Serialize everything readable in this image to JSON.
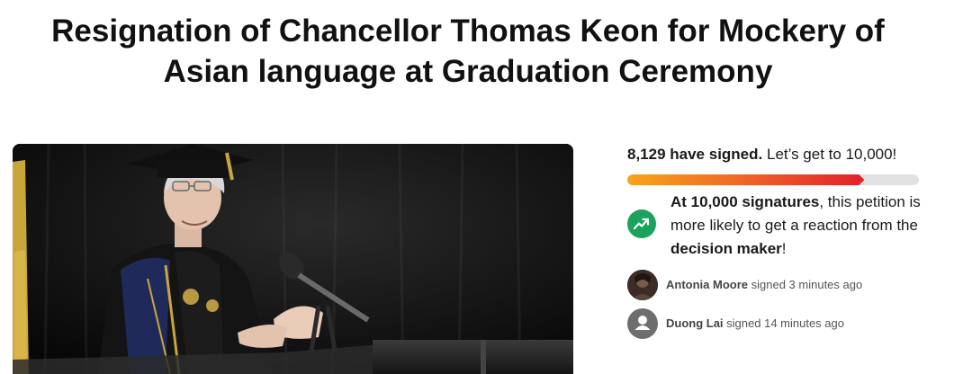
{
  "petition": {
    "title_line1": "Resignation of Chancellor Thomas Keon for Mockery of",
    "title_line2": "Asian language at Graduation Ceremony"
  },
  "progress": {
    "signed_count_text": "8,129 have signed.",
    "goal_text": "Let’s get to 10,000!",
    "signed": 8129,
    "goal": 10000,
    "gradient_colors": [
      "#f7a41c",
      "#f06a26",
      "#e3202d"
    ],
    "track_color": "#e2e2e2"
  },
  "milestone": {
    "icon": "trending-up-icon",
    "icon_color": "#1aa35c",
    "bold_part": "At 10,000 signatures",
    "middle_part": ", this petition is more likely to get a reaction from the ",
    "decision_maker": "decision maker",
    "end": "!"
  },
  "recent_signers": [
    {
      "name": "Antonia Moore",
      "action": "signed 3 minutes ago",
      "avatar": "photo-avatar"
    },
    {
      "name": "Duong Lai",
      "action": "signed 14 minutes ago",
      "avatar": "default-user-icon"
    }
  ]
}
